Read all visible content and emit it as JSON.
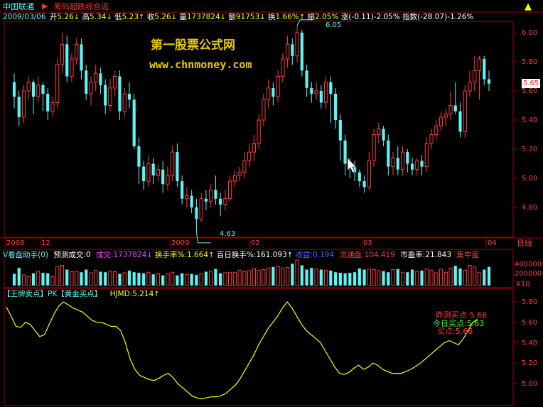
{
  "header": {
    "stock_name": "中国联通",
    "indicator_name": "筹码超跌综合选",
    "date": "2009/03/06",
    "open_label": "开",
    "open": "5.26",
    "high_label": "高",
    "high": "5.34",
    "low_label": "低",
    "low": "5.23",
    "close_label": "收",
    "close": "5.26",
    "volume_label": "量",
    "volume": "1737824",
    "amount_label": "额",
    "amount": "91753",
    "turnover_label": "换",
    "turnover": "1.66%",
    "amplitude_label": "振",
    "amplitude": "2.05%",
    "change": "涨(-0.11)-2.05%",
    "index": "指数(-28.07)-1.26%"
  },
  "watermark": {
    "line1": "第一股票公式网",
    "line2": "www.chnmoney.com"
  },
  "price_panel": {
    "price_labels": [
      "6.00",
      "5.80",
      "5.60",
      "5.40",
      "5.20",
      "5.00",
      "4.80"
    ],
    "current_price": "5.65",
    "max_marker": "6.05",
    "min_marker": "4.63"
  },
  "time_axis": {
    "labels": [
      "2008",
      "12",
      "2009",
      "02",
      "03",
      "04"
    ],
    "period_label": "日线"
  },
  "volume_panel": {
    "title": "V看盘助手(0)",
    "predict_label": "预测成交:0",
    "vol_label": "成交:1737824",
    "turnover_rate": "换手率%:1.664",
    "turnover_100": "百日换手%:161.093",
    "eps": "收益:0.194",
    "float_cap": "流通盘:104.419",
    "pe": "市盈率:21.843",
    "concentration": "集中度",
    "axis_labels": [
      "400000",
      "200000"
    ],
    "scale": "X10"
  },
  "indicator_panel": {
    "title": "【王牌卖点】PK【黄金买点】",
    "value_label": "HJMD:5.214",
    "axis_labels": [
      "5.80",
      "5.60",
      "5.40",
      "5.20",
      "5.00"
    ],
    "annotations": {
      "yesterday": "昨测买点:5.66",
      "today": "今日买点:5.63",
      "buy": "买点:5.66"
    }
  },
  "colors": {
    "up": "#ff3c3c",
    "down": "#5cf4f4",
    "line": "#ffff00",
    "grid": "#800000",
    "border": "#a00000"
  },
  "chart_data": {
    "type": "candlestick",
    "candles": [
      [
        5.66,
        5.56,
        5.72,
        5.48
      ],
      [
        5.56,
        5.42,
        5.6,
        5.36
      ],
      [
        5.42,
        5.6,
        5.64,
        5.38
      ],
      [
        5.6,
        5.66,
        5.7,
        5.54
      ],
      [
        5.66,
        5.56,
        5.68,
        5.44
      ],
      [
        5.56,
        5.64,
        5.7,
        5.52
      ],
      [
        5.64,
        5.58,
        5.66,
        5.46
      ],
      [
        5.58,
        5.46,
        5.62,
        5.4
      ],
      [
        5.46,
        5.52,
        5.56,
        5.42
      ],
      [
        5.52,
        5.78,
        5.82,
        5.48
      ],
      [
        5.78,
        5.92,
        6.0,
        5.72
      ],
      [
        5.92,
        5.7,
        5.98,
        5.66
      ],
      [
        5.7,
        5.82,
        5.86,
        5.66
      ],
      [
        5.82,
        5.92,
        5.96,
        5.78
      ],
      [
        5.92,
        5.74,
        5.96,
        5.68
      ],
      [
        5.74,
        5.58,
        5.78,
        5.54
      ],
      [
        5.58,
        5.66,
        5.7,
        5.5
      ],
      [
        5.66,
        5.72,
        5.78,
        5.6
      ],
      [
        5.72,
        5.64,
        5.76,
        5.58
      ],
      [
        5.64,
        5.5,
        5.68,
        5.44
      ],
      [
        5.5,
        5.62,
        5.68,
        5.46
      ],
      [
        5.62,
        5.7,
        5.74,
        5.56
      ],
      [
        5.7,
        5.46,
        5.74,
        5.4
      ],
      [
        5.46,
        5.58,
        5.62,
        5.42
      ],
      [
        5.58,
        5.54,
        5.66,
        5.48
      ],
      [
        5.54,
        5.22,
        5.58,
        5.2
      ],
      [
        5.22,
        5.08,
        5.28,
        4.96
      ],
      [
        5.08,
        4.98,
        5.12,
        4.92
      ],
      [
        4.98,
        5.1,
        5.16,
        4.94
      ],
      [
        5.1,
        5.02,
        5.14,
        4.96
      ],
      [
        5.02,
        5.06,
        5.1,
        4.98
      ],
      [
        5.06,
        4.96,
        5.12,
        4.9
      ],
      [
        4.96,
        5.02,
        5.08,
        4.92
      ],
      [
        5.02,
        5.18,
        5.22,
        4.98
      ],
      [
        5.18,
        4.98,
        5.24,
        4.94
      ],
      [
        4.98,
        4.86,
        5.02,
        4.82
      ],
      [
        4.86,
        4.88,
        4.94,
        4.8
      ],
      [
        4.88,
        4.8,
        4.92,
        4.76
      ],
      [
        4.8,
        4.72,
        4.86,
        4.63
      ],
      [
        4.72,
        4.86,
        4.9,
        4.7
      ],
      [
        4.86,
        4.84,
        4.92,
        4.78
      ],
      [
        4.84,
        4.92,
        4.96,
        4.8
      ],
      [
        4.92,
        4.86,
        5.02,
        4.82
      ],
      [
        4.86,
        4.82,
        4.9,
        4.74
      ],
      [
        4.82,
        4.86,
        4.92,
        4.78
      ],
      [
        4.86,
        4.98,
        5.02,
        4.84
      ],
      [
        4.98,
        5.02,
        5.06,
        4.94
      ],
      [
        5.02,
        5.04,
        5.08,
        4.98
      ],
      [
        5.04,
        5.12,
        5.18,
        5.0
      ],
      [
        5.12,
        5.18,
        5.24,
        5.08
      ],
      [
        5.18,
        5.24,
        5.3,
        5.12
      ],
      [
        5.24,
        5.4,
        5.44,
        5.2
      ],
      [
        5.4,
        5.54,
        5.58,
        5.36
      ],
      [
        5.54,
        5.62,
        5.68,
        5.48
      ],
      [
        5.62,
        5.56,
        5.66,
        5.5
      ],
      [
        5.56,
        5.7,
        5.74,
        5.52
      ],
      [
        5.7,
        5.82,
        5.86,
        5.66
      ],
      [
        5.82,
        5.92,
        5.98,
        5.76
      ],
      [
        5.92,
        5.84,
        5.96,
        5.78
      ],
      [
        5.84,
        6.0,
        6.05,
        5.8
      ],
      [
        6.0,
        5.74,
        6.02,
        5.7
      ],
      [
        5.74,
        5.62,
        5.78,
        5.56
      ],
      [
        5.62,
        5.58,
        5.66,
        5.52
      ],
      [
        5.58,
        5.6,
        5.66,
        5.54
      ],
      [
        5.6,
        5.52,
        5.64,
        5.48
      ],
      [
        5.52,
        5.66,
        5.7,
        5.48
      ],
      [
        5.66,
        5.58,
        5.7,
        5.38
      ],
      [
        5.58,
        5.4,
        5.62,
        5.34
      ],
      [
        5.4,
        5.26,
        5.44,
        5.12
      ],
      [
        5.26,
        5.1,
        5.3,
        5.02
      ],
      [
        5.1,
        5.08,
        5.14,
        5.0
      ],
      [
        5.08,
        5.04,
        5.12,
        4.98
      ],
      [
        5.04,
        4.98,
        5.06,
        4.94
      ],
      [
        4.98,
        4.94,
        5.02,
        4.9
      ],
      [
        4.94,
        5.12,
        5.18,
        4.92
      ],
      [
        5.12,
        5.3,
        5.34,
        5.08
      ],
      [
        5.3,
        5.34,
        5.38,
        5.24
      ],
      [
        5.34,
        5.26,
        5.36,
        5.22
      ],
      [
        5.26,
        5.08,
        5.3,
        5.02
      ],
      [
        5.08,
        5.14,
        5.18,
        5.02
      ],
      [
        5.14,
        5.06,
        5.22,
        5.02
      ],
      [
        5.06,
        5.18,
        5.22,
        5.02
      ],
      [
        5.18,
        5.1,
        5.2,
        5.04
      ],
      [
        5.1,
        5.06,
        5.14,
        5.02
      ],
      [
        5.06,
        5.12,
        5.14,
        5.02
      ],
      [
        5.12,
        5.08,
        5.16,
        5.02
      ],
      [
        5.08,
        5.24,
        5.28,
        5.04
      ],
      [
        5.24,
        5.3,
        5.34,
        5.2
      ],
      [
        5.3,
        5.36,
        5.4,
        5.26
      ],
      [
        5.36,
        5.42,
        5.46,
        5.32
      ],
      [
        5.42,
        5.44,
        5.48,
        5.36
      ],
      [
        5.44,
        5.5,
        5.6,
        5.4
      ],
      [
        5.5,
        5.46,
        5.66,
        5.44
      ],
      [
        5.46,
        5.32,
        5.52,
        5.28
      ],
      [
        5.32,
        5.6,
        5.64,
        5.28
      ],
      [
        5.6,
        5.66,
        5.74,
        5.56
      ],
      [
        5.66,
        5.74,
        5.84,
        5.6
      ],
      [
        5.74,
        5.82,
        5.84,
        5.54
      ],
      [
        5.82,
        5.68,
        5.84,
        5.64
      ],
      [
        5.68,
        5.65,
        5.74,
        5.6
      ]
    ],
    "volume": [
      220000,
      330000,
      200000,
      170000,
      230000,
      270000,
      240000,
      230000,
      170000,
      360000,
      380000,
      300000,
      260000,
      270000,
      250000,
      300000,
      240000,
      290000,
      260000,
      250000,
      270000,
      260000,
      220000,
      240000,
      280000,
      250000,
      240000,
      230000,
      250000,
      210000,
      220000,
      190000,
      220000,
      250000,
      190000,
      230000,
      210000,
      220000,
      200000,
      220000,
      260000,
      270000,
      310000,
      230000,
      240000,
      250000,
      250000,
      290000,
      260000,
      280000,
      320000,
      290000,
      300000,
      330000,
      350000,
      360000,
      330000,
      340000,
      410000,
      480000,
      380000,
      300000,
      330000,
      310000,
      300000,
      290000,
      280000,
      250000,
      240000,
      230000,
      240000,
      250000,
      320000,
      300000,
      310000,
      300000,
      280000,
      270000,
      250000,
      300000,
      310000,
      250000,
      250000,
      300000,
      270000,
      280000,
      310000,
      290000,
      240000,
      310000,
      250000,
      330000,
      370000,
      320000,
      290000,
      380000,
      350000,
      250000,
      300000,
      350000
    ],
    "hjmd": [
      5.75,
      5.66,
      5.56,
      5.55,
      5.6,
      5.58,
      5.52,
      5.46,
      5.48,
      5.58,
      5.68,
      5.76,
      5.8,
      5.77,
      5.74,
      5.72,
      5.7,
      5.66,
      5.62,
      5.6,
      5.6,
      5.58,
      5.56,
      5.56,
      5.52,
      5.4,
      5.24,
      5.14,
      5.08,
      5.06,
      5.04,
      5.03,
      5.05,
      5.08,
      5.1,
      5.06,
      5.0,
      4.96,
      4.92,
      4.88,
      4.86,
      4.85,
      4.86,
      4.87,
      4.87,
      4.88,
      4.9,
      4.94,
      4.98,
      5.04,
      5.12,
      5.2,
      5.28,
      5.38,
      5.46,
      5.54,
      5.6,
      5.66,
      5.74,
      5.8,
      5.74,
      5.66,
      5.58,
      5.52,
      5.48,
      5.44,
      5.4,
      5.32,
      5.24,
      5.16,
      5.1,
      5.09,
      5.11,
      5.15,
      5.18,
      5.14,
      5.16,
      5.2,
      5.18,
      5.14,
      5.12,
      5.1,
      5.1,
      5.1,
      5.12,
      5.14,
      5.17,
      5.2,
      5.24,
      5.28,
      5.32,
      5.36,
      5.4,
      5.42,
      5.4,
      5.38,
      5.44,
      5.52,
      5.6,
      5.63
    ]
  }
}
